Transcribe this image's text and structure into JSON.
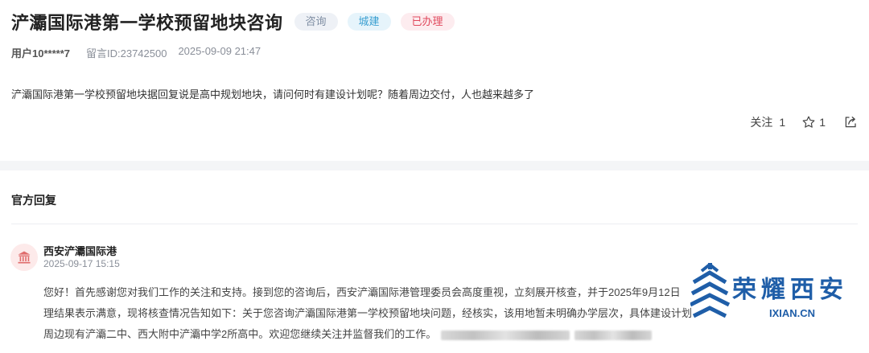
{
  "question": {
    "title": "浐灞国际港第一学校预留地块咨询",
    "tags": [
      "咨询",
      "城建",
      "已办理"
    ],
    "user": "用户10*****7",
    "message_id": "留言ID:23742500",
    "timestamp": "2025-09-09 21:47",
    "body": "浐灞国际港第一学校预留地块据回复说是高中规划地块，请问何时有建设计划呢？随着周边交付，人也越来越多了",
    "follow_label": "关注",
    "follow_count": "1",
    "star_count": "1",
    "icons": {
      "star": "star-icon",
      "share": "share-icon"
    }
  },
  "reply": {
    "heading": "官方回复",
    "org_name": "西安浐灞国际港",
    "org_time": "2025-09-17 15:15",
    "org_icon": "government-building-icon",
    "lines": [
      "您好！首先感谢您对我们工作的关注和支持。接到您的咨询后，西安浐灞国际港管理委员会高度重视，立刻展开核查，并于2025年9月12日",
      "理结果表示满意，现将核查情况告知如下：关于您咨询浐灞国际港第一学校预留地块问题，经核实，该用地暂未明确办学层次，具体建设计划",
      "周边现有浐灞二中、西大附中浐灞中学2所高中。欢迎您继续关注并监督我们的工作。"
    ]
  },
  "watermark": {
    "logo_text": "荣耀西安",
    "url": "IXIAN.CN"
  },
  "colors": {
    "tag_consult": "#7f8ea3",
    "tag_city": "#3a9fd1",
    "tag_done": "#e0485c",
    "brand_blue": "#1f5ea8"
  }
}
